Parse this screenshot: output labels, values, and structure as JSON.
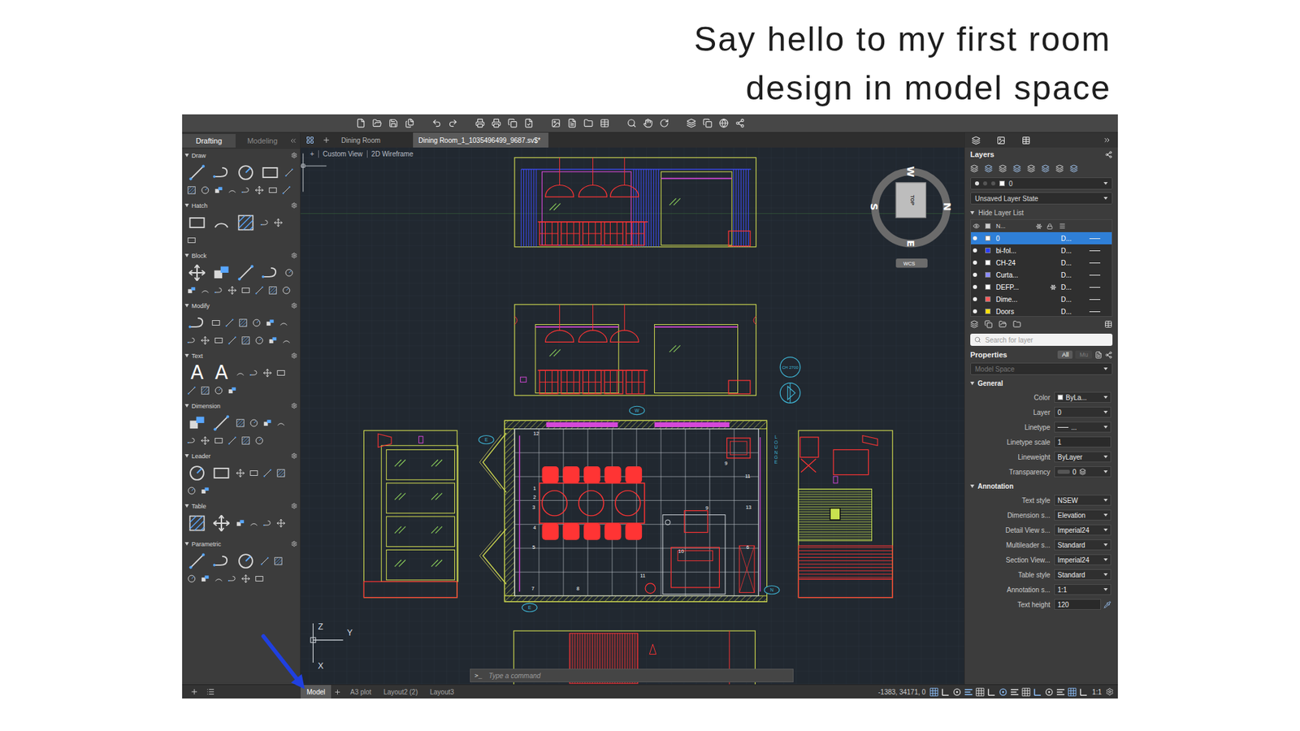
{
  "heading": {
    "lines": [
      "Say hello to my first room",
      "design in model space"
    ]
  },
  "leftPanel": {
    "tabs": [
      {
        "label": "Drafting",
        "selected": true
      },
      {
        "label": "Modeling",
        "selected": false
      }
    ],
    "sections": [
      {
        "title": "Draw",
        "expanded": true
      },
      {
        "title": "Hatch",
        "expanded": true
      },
      {
        "title": "Block",
        "expanded": true
      },
      {
        "title": "Modify",
        "expanded": true
      },
      {
        "title": "Text",
        "expanded": true,
        "glyphs": [
          "A",
          "A"
        ]
      },
      {
        "title": "Dimension",
        "expanded": true
      },
      {
        "title": "Leader",
        "expanded": true
      },
      {
        "title": "Table",
        "expanded": true
      },
      {
        "title": "Parametric",
        "expanded": true
      }
    ]
  },
  "documentTabs": [
    {
      "label": "Dining Room",
      "selected": false
    },
    {
      "label": "Dining Room_1_1035496499_9687.sv$*",
      "selected": true
    }
  ],
  "viewport": {
    "controls": [
      "+",
      "Custom View",
      "2D Wireframe"
    ]
  },
  "viewCube": {
    "face": "TOP",
    "north": "N",
    "south": "S",
    "east": "E",
    "west": "W",
    "system": "WCS"
  },
  "ucs": {
    "x": "X",
    "y": "Y",
    "z": "Z"
  },
  "drawing": {
    "callouts": [
      "W",
      "E",
      "N",
      "E"
    ],
    "ceilingHeight": "CH 2700",
    "roomLabel": "LOUNGE",
    "itemNumbers": [
      "12",
      "1",
      "2",
      "3",
      "4",
      "5",
      "7",
      "8",
      "11",
      "10",
      "9",
      "9",
      "11",
      "13",
      "6"
    ]
  },
  "commandLine": {
    "prompt": ">_",
    "placeholder": "Type a command"
  },
  "statusBar": {
    "layouts": [
      {
        "label": "Model",
        "selected": true
      },
      {
        "label": "A3 plot",
        "selected": false
      },
      {
        "label": "Layout2 (2)",
        "selected": false
      },
      {
        "label": "Layout3",
        "selected": false
      }
    ],
    "coordinates": "-1383, 34171, 0",
    "scale": "1:1"
  },
  "rightPanel": {
    "layers": {
      "title": "Layers",
      "currentLayer": "0",
      "layerState": "Unsaved Layer State",
      "toggle": "Hide Layer List",
      "nameColumn": "N...",
      "searchPlaceholder": "Search for layer",
      "items": [
        {
          "name": "0",
          "description": "D...",
          "color": "#ffffff",
          "selected": true,
          "frozen": false
        },
        {
          "name": "bi-fol...",
          "description": "D...",
          "color": "#2a3cff",
          "selected": false,
          "frozen": false
        },
        {
          "name": "CH-24",
          "description": "D...",
          "color": "#ffffff",
          "selected": false,
          "frozen": false
        },
        {
          "name": "Curta...",
          "description": "D...",
          "color": "#8a8aff",
          "selected": false,
          "frozen": false
        },
        {
          "name": "DEFP...",
          "description": "D...",
          "color": "#ffffff",
          "selected": false,
          "frozen": true
        },
        {
          "name": "Dime...",
          "description": "D...",
          "color": "#ff5a5a",
          "selected": false,
          "frozen": false
        },
        {
          "name": "Doors",
          "description": "D...",
          "color": "#ffe000",
          "selected": false,
          "frozen": false
        }
      ]
    },
    "properties": {
      "title": "Properties",
      "filters": [
        {
          "label": "All",
          "selected": true
        },
        {
          "label": "Mu",
          "selected": false
        }
      ],
      "scope": "Model Space",
      "sections": [
        {
          "title": "General",
          "expanded": true,
          "rows": [
            {
              "label": "Color",
              "value": "ByLa...",
              "kind": "color"
            },
            {
              "label": "Layer",
              "value": "0",
              "kind": "select"
            },
            {
              "label": "Linetype",
              "value": "...",
              "kind": "linetype"
            },
            {
              "label": "Linetype scale",
              "value": "1",
              "kind": "input"
            },
            {
              "label": "Lineweight",
              "value": "ByLayer",
              "kind": "select"
            },
            {
              "label": "Transparency",
              "value": "0",
              "kind": "transparency"
            }
          ]
        },
        {
          "title": "Annotation",
          "expanded": true,
          "rows": [
            {
              "label": "Text style",
              "value": "NSEW",
              "kind": "select"
            },
            {
              "label": "Dimension s...",
              "value": "Elevation",
              "kind": "select"
            },
            {
              "label": "Detail View s...",
              "value": "Imperial24",
              "kind": "select"
            },
            {
              "label": "Multileader s...",
              "value": "Standard",
              "kind": "select"
            },
            {
              "label": "Section View...",
              "value": "Imperial24",
              "kind": "select"
            },
            {
              "label": "Table style",
              "value": "Standard",
              "kind": "select"
            },
            {
              "label": "Annotation s...",
              "value": "1:1",
              "kind": "select"
            },
            {
              "label": "Text height",
              "value": "120",
              "kind": "pick"
            }
          ]
        }
      ]
    }
  }
}
